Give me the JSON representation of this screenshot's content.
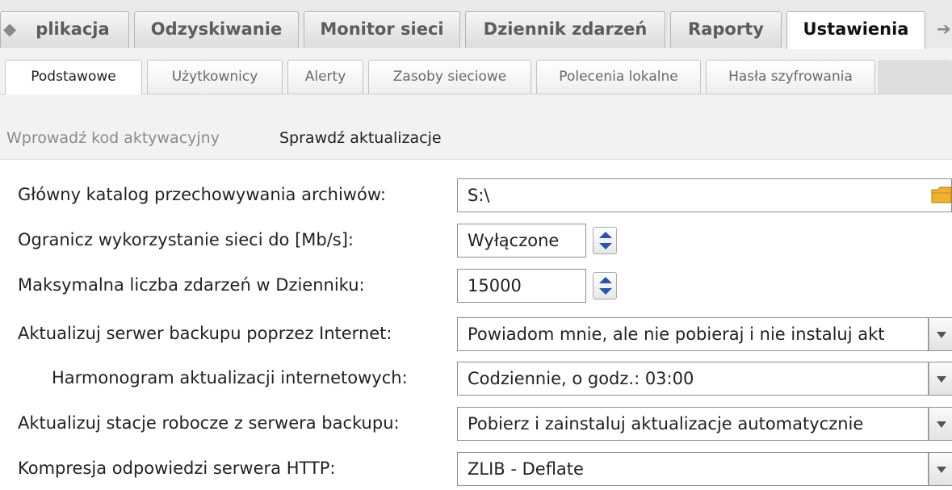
{
  "main_tabs": {
    "scroll_left": "◆",
    "scroll_right": "➔",
    "items": [
      {
        "label": "plikacja"
      },
      {
        "label": "Odzyskiwanie"
      },
      {
        "label": "Monitor sieci"
      },
      {
        "label": "Dziennik zdarzeń"
      },
      {
        "label": "Raporty"
      },
      {
        "label": "Ustawienia",
        "active": true
      }
    ]
  },
  "sub_tabs": {
    "items": [
      {
        "label": "Podstawowe",
        "active": true
      },
      {
        "label": "Użytkownicy"
      },
      {
        "label": "Alerty"
      },
      {
        "label": "Zasoby sieciowe"
      },
      {
        "label": "Polecenia lokalne"
      },
      {
        "label": "Hasła szyfrowania"
      }
    ]
  },
  "actions": {
    "activation_code": "Wprowadź kod aktywacyjny",
    "check_updates": "Sprawdź aktualizacje"
  },
  "form": {
    "archive_dir": {
      "label": "Główny katalog przechowywania archiwów:",
      "value": "S:\\",
      "icon": "folder-icon"
    },
    "network_limit": {
      "label": "Ogranicz wykorzystanie sieci do [Mb/s]:",
      "value": "Wyłączone"
    },
    "max_events": {
      "label": "Maksymalna liczba zdarzeń w Dzienniku:",
      "value": "15000"
    },
    "update_server": {
      "label": "Aktualizuj serwer backupu poprzez Internet:",
      "value": "Powiadom mnie, ale nie pobieraj i nie instaluj akt"
    },
    "update_schedule": {
      "label": "Harmonogram aktualizacji internetowych:",
      "value": "Codziennie, o godz.: 03:00"
    },
    "update_workstations": {
      "label": "Aktualizuj stacje robocze z serwera backupu:",
      "value": "Pobierz i zainstaluj aktualizacje automatycznie"
    },
    "http_compression": {
      "label": "Kompresja odpowiedzi serwera HTTP:",
      "value": "ZLIB - Deflate"
    }
  },
  "colors": {
    "accent_blue": "#2a55a3",
    "folder_yellow": "#f0b030"
  }
}
